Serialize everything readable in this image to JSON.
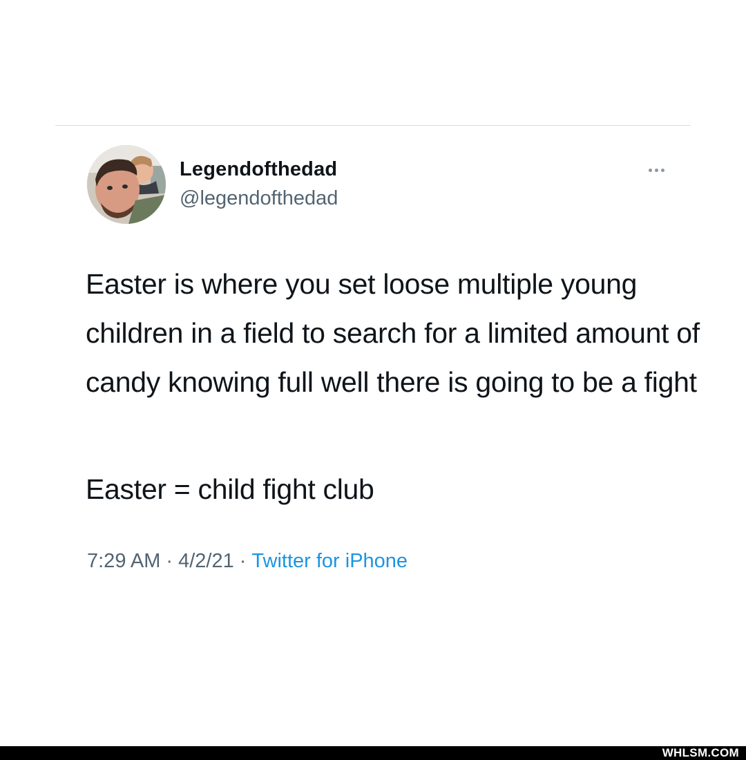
{
  "tweet": {
    "author": {
      "display_name": "Legendofthedad",
      "handle": "@legendofthedad"
    },
    "text_paragraphs": [
      "Easter is where you set loose multiple young children in a field to search for a limited amount of candy knowing full well there is going to be a fight",
      "Easter = child fight club"
    ],
    "time": "7:29 AM",
    "date": "4/2/21",
    "separator": "·",
    "source": "Twitter for iPhone",
    "more_icon": "more-horizontal-icon"
  },
  "watermark": {
    "text": "WHLSM.COM"
  },
  "colors": {
    "text_primary": "#0f1419",
    "text_secondary": "#536471",
    "link": "#1b95e0",
    "divider": "#d9dde1",
    "footer_bar": "#000000"
  }
}
